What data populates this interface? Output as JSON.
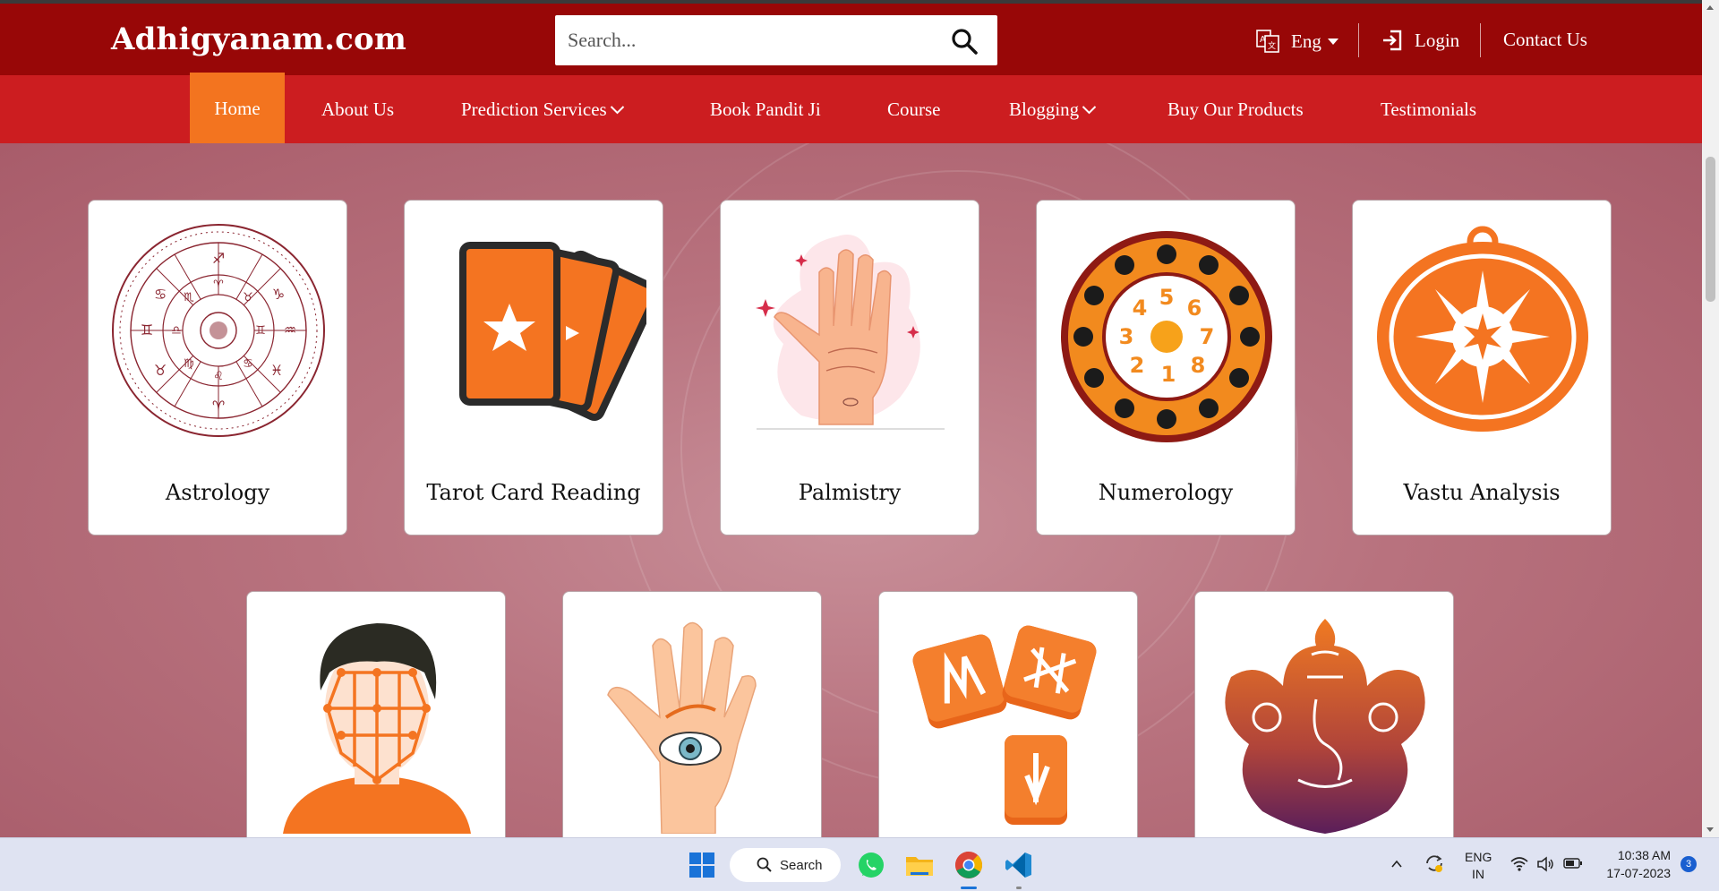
{
  "header": {
    "logo": "Adhigyanam.com",
    "search_placeholder": "Search...",
    "language": "Eng",
    "login": "Login",
    "contact": "Contact Us"
  },
  "nav": {
    "items": [
      {
        "label": "Home",
        "active": true,
        "dropdown": false
      },
      {
        "label": "About Us",
        "active": false,
        "dropdown": false
      },
      {
        "label": "Prediction Services",
        "active": false,
        "dropdown": true
      },
      {
        "label": "Book Pandit Ji",
        "active": false,
        "dropdown": false
      },
      {
        "label": "Course",
        "active": false,
        "dropdown": false
      },
      {
        "label": "Blogging",
        "active": false,
        "dropdown": true
      },
      {
        "label": "Buy Our Products",
        "active": false,
        "dropdown": false
      },
      {
        "label": "Testimonials",
        "active": false,
        "dropdown": false
      }
    ]
  },
  "services": [
    {
      "title": "Astrology",
      "icon": "zodiac-wheel-icon"
    },
    {
      "title": "Tarot Card Reading",
      "icon": "tarot-cards-icon"
    },
    {
      "title": "Palmistry",
      "icon": "palm-lines-icon"
    },
    {
      "title": "Numerology",
      "icon": "numerology-wheel-icon"
    },
    {
      "title": "Vastu Analysis",
      "icon": "vastu-sun-icon"
    },
    {
      "title": "",
      "icon": "face-reading-icon"
    },
    {
      "title": "",
      "icon": "hand-eye-icon"
    },
    {
      "title": "",
      "icon": "rune-stones-icon"
    },
    {
      "title": "",
      "icon": "ganesha-icon"
    }
  ],
  "colors": {
    "header_bg": "#980707",
    "nav_bg": "#cc1d20",
    "active_tab": "#f3741f",
    "accent_orange": "#f47421"
  },
  "taskbar": {
    "search": "Search",
    "lang_top": "ENG",
    "lang_bottom": "IN",
    "time": "10:38 AM",
    "date": "17-07-2023",
    "notifications": "3"
  }
}
